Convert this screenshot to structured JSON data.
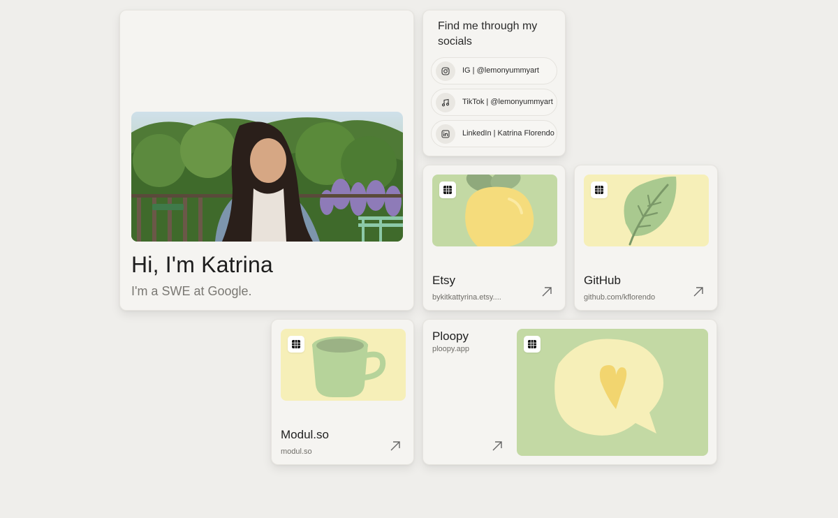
{
  "profile": {
    "name": "Hi, I'm Katrina",
    "bio": "I'm a SWE at Google."
  },
  "socials": {
    "title": "Find me through my socials",
    "items": [
      {
        "label": "IG | @lemonyummyart",
        "icon": "instagram-icon"
      },
      {
        "label": "TikTok | @lemonyummyart",
        "icon": "music-note-icon"
      },
      {
        "label": "LinkedIn | Katrina Florendo",
        "icon": "linkedin-icon"
      }
    ]
  },
  "links": {
    "etsy": {
      "title": "Etsy",
      "subtitle": "bykitkattyrina.etsy....",
      "icon": "grid-logo-icon",
      "illustration": "lemon"
    },
    "github": {
      "title": "GitHub",
      "subtitle": "github.com/kflorendo",
      "icon": "grid-logo-icon",
      "illustration": "leaf"
    },
    "modul": {
      "title": "Modul.so",
      "subtitle": "modul.so",
      "icon": "grid-logo-icon",
      "illustration": "mug"
    },
    "ploopy": {
      "title": "Ploopy",
      "subtitle": "ploopy.app",
      "icon": "grid-logo-icon",
      "illustration": "heart-speech-bubble"
    }
  },
  "colors": {
    "background": "#efeeeb",
    "card": "#f5f4f1",
    "sage": "#c3d9a4",
    "butter": "#f6efb8",
    "lemon": "#f5dc7c",
    "leaf": "#a9c98f"
  }
}
